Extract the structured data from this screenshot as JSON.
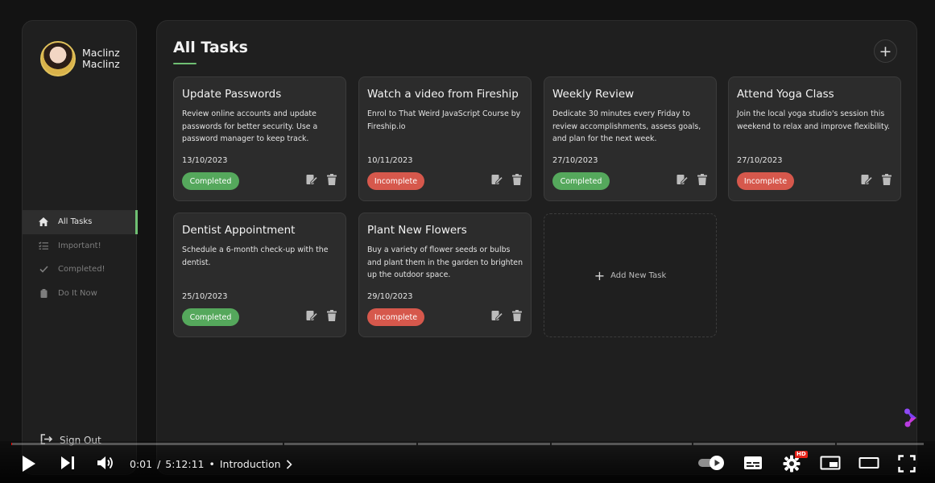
{
  "user": {
    "first_name": "Maclinz",
    "last_name": "Maclinz"
  },
  "sidebar": {
    "items": [
      {
        "label": "All Tasks",
        "icon": "home-icon"
      },
      {
        "label": "Important!",
        "icon": "list-check-icon"
      },
      {
        "label": "Completed!",
        "icon": "check-icon"
      },
      {
        "label": "Do It Now",
        "icon": "clipboard-icon"
      }
    ],
    "signout_label": "Sign Out"
  },
  "main": {
    "title": "All Tasks",
    "add_task_label": "Add New Task",
    "tasks": [
      {
        "title": "Update Passwords",
        "description": "Review online accounts and update passwords for better security. Use a password manager to keep track.",
        "date": "13/10/2023",
        "status": "Completed"
      },
      {
        "title": "Watch a video from Fireship",
        "description": "Enrol to That Weird JavaScript Course by Fireship.io",
        "date": "10/11/2023",
        "status": "Incomplete"
      },
      {
        "title": "Weekly Review",
        "description": "Dedicate 30 minutes every Friday to review accomplishments, assess goals, and plan for the next week.",
        "date": "27/10/2023",
        "status": "Completed"
      },
      {
        "title": "Attend Yoga Class",
        "description": "Join the local yoga studio's session this weekend to relax and improve flexibility.",
        "date": "27/10/2023",
        "status": "Incomplete"
      },
      {
        "title": "Dentist Appointment",
        "description": "Schedule a 6-month check-up with the dentist.",
        "date": "25/10/2023",
        "status": "Completed"
      },
      {
        "title": "Plant New Flowers",
        "description": "Buy a variety of flower seeds or bulbs and plant them in the garden to brighten up the outdoor space.",
        "date": "29/10/2023",
        "status": "Incomplete"
      }
    ]
  },
  "colors": {
    "accent": "#6fbf73",
    "completed": "#55a85c",
    "incomplete": "#d6584c"
  },
  "player": {
    "current_time": "0:01",
    "duration": "5:12:11",
    "separator": "/",
    "bullet": "•",
    "chapter": "Introduction",
    "progress_fraction": 0.0001,
    "hd_badge": "HD"
  }
}
